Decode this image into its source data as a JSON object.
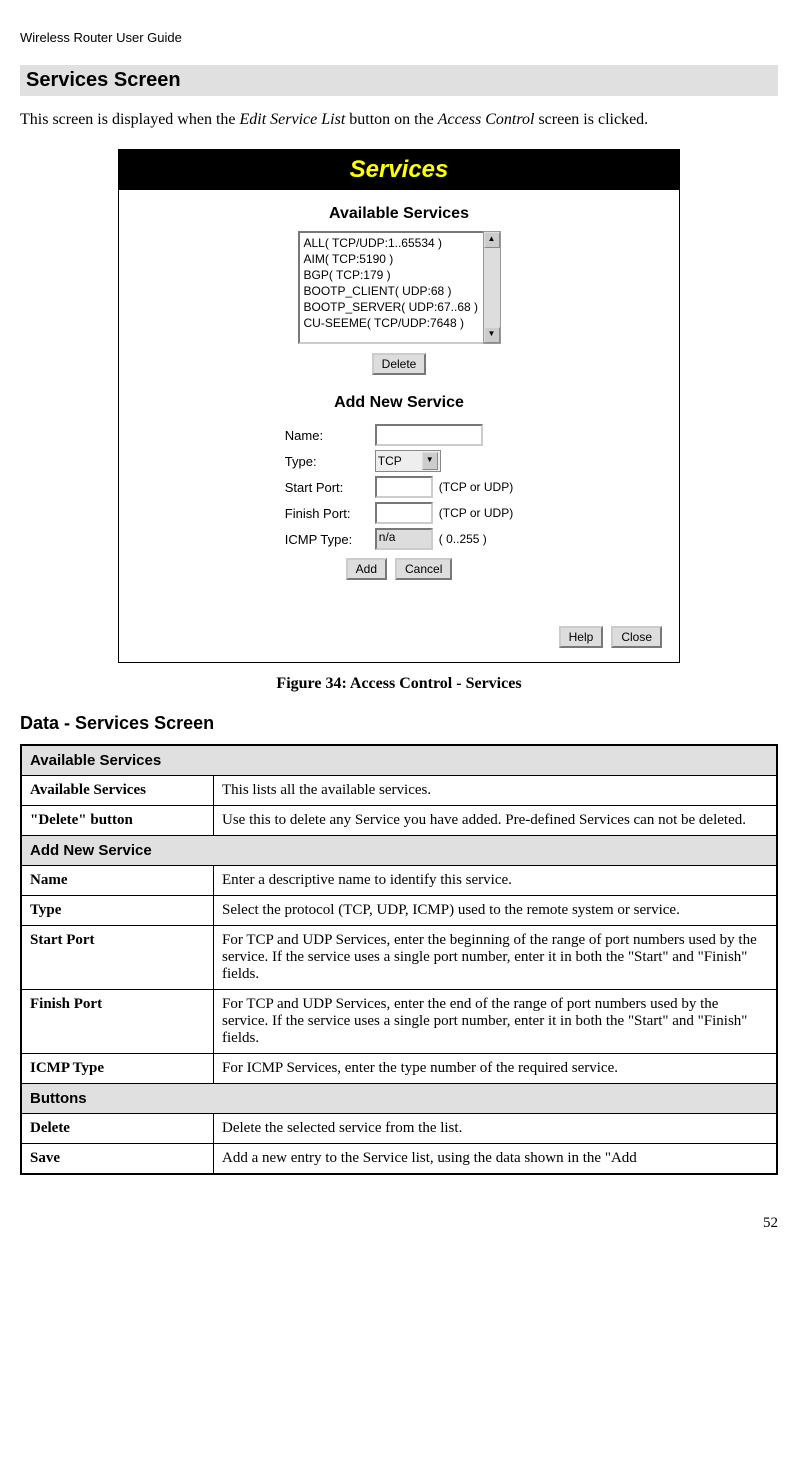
{
  "header": "Wireless Router User Guide",
  "section_title": "Services Screen",
  "intro": {
    "pre1": "This screen is displayed when the ",
    "italic1": "Edit Service List",
    "mid1": " button on the ",
    "italic2": "Access Control",
    "post1": " screen is clicked."
  },
  "dialog": {
    "title": "Services",
    "available_title": "Available Services",
    "items": [
      "ALL( TCP/UDP:1..65534 )",
      "AIM( TCP:5190 )",
      "BGP( TCP:179 )",
      "BOOTP_CLIENT( UDP:68 )",
      "BOOTP_SERVER( UDP:67..68 )",
      "CU-SEEME( TCP/UDP:7648 )"
    ],
    "delete_btn": "Delete",
    "add_title": "Add New Service",
    "name_label": "Name:",
    "type_label": "Type:",
    "type_value": "TCP",
    "start_label": "Start Port:",
    "finish_label": "Finish Port:",
    "tcp_udp_suffix": "(TCP or UDP)",
    "icmp_label": "ICMP Type:",
    "icmp_value": "n/a",
    "icmp_suffix": "( 0..255 )",
    "add_btn": "Add",
    "cancel_btn": "Cancel",
    "help_btn": "Help",
    "close_btn": "Close"
  },
  "figure_caption": "Figure 34: Access Control - Services",
  "data_heading": "Data - Services Screen",
  "table": {
    "sec1": "Available Services",
    "r1_label": "Available Services",
    "r1_text": "This lists all the available services.",
    "r2_label": "\"Delete\" button",
    "r2_text": "Use this to delete any Service you have added. Pre-defined Services can not be deleted.",
    "sec2": "Add New Service",
    "r3_label": "Name",
    "r3_text": "Enter a descriptive name to identify this service.",
    "r4_label": "Type",
    "r4_text": "Select the protocol (TCP, UDP, ICMP) used to the remote system or service.",
    "r5_label": "Start Port",
    "r5_text": "For TCP and UDP Services, enter the beginning of the range of port numbers used by the service. If the service uses a single port number, enter it in both the \"Start\" and \"Finish\" fields.",
    "r6_label": "Finish Port",
    "r6_text": "For TCP and UDP Services, enter the end of the range of port numbers used by the service. If the service uses a single port number, enter it in both the \"Start\" and \"Finish\" fields.",
    "r7_label": "ICMP Type",
    "r7_text": "For ICMP Services, enter the type number of the required service.",
    "sec3": "Buttons",
    "r8_label": "Delete",
    "r8_text": "Delete the selected service from the list.",
    "r9_label": "Save",
    "r9_text": "Add a new entry to the Service list, using the data shown in the \"Add"
  },
  "page_number": "52"
}
